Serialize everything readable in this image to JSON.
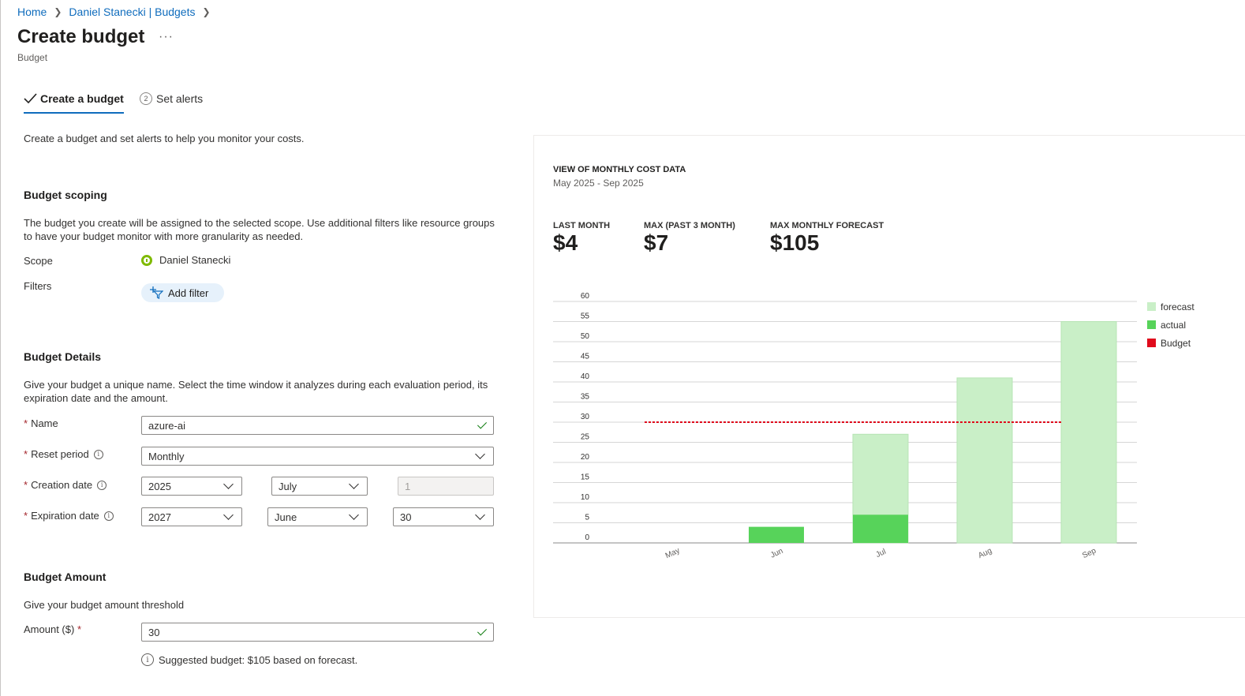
{
  "breadcrumb": {
    "home": "Home",
    "parent": "Daniel Stanecki | Budgets"
  },
  "page": {
    "title": "Create budget",
    "more": "···",
    "subtitle": "Budget"
  },
  "tabs": [
    {
      "label": "Create a budget",
      "state": "complete"
    },
    {
      "label": "Set alerts",
      "step": "2"
    }
  ],
  "intro": "Create a budget and set alerts to help you monitor your costs.",
  "scoping": {
    "title": "Budget scoping",
    "description": "The budget you create will be assigned to the selected scope. Use additional filters like resource groups to have your budget monitor with more granularity as needed.",
    "scope_label": "Scope",
    "scope_value": "Daniel Stanecki",
    "filters_label": "Filters",
    "add_filter": "Add filter"
  },
  "details": {
    "title": "Budget Details",
    "description": "Give your budget a unique name. Select the time window it analyzes during each evaluation period, its expiration date and the amount.",
    "name_label": "Name",
    "name_value": "azure-ai",
    "reset_label": "Reset period",
    "reset_value": "Monthly",
    "creation_label": "Creation date",
    "creation_year": "2025",
    "creation_month": "July",
    "creation_day": "1",
    "expiration_label": "Expiration date",
    "expiration_year": "2027",
    "expiration_month": "June",
    "expiration_day": "30"
  },
  "amount": {
    "title": "Budget Amount",
    "description": "Give your budget amount threshold",
    "label": "Amount ($)",
    "value": "30",
    "suggestion": "Suggested budget: $105 based on forecast."
  },
  "summary": {
    "title": "VIEW OF MONTHLY COST DATA",
    "range": "May 2025 - Sep 2025",
    "kpis": [
      {
        "label": "LAST MONTH",
        "value": "$4"
      },
      {
        "label": "MAX (PAST 3 MONTH)",
        "value": "$7"
      },
      {
        "label": "MAX MONTHLY FORECAST",
        "value": "$105"
      }
    ]
  },
  "colors": {
    "forecast": "#c9efc7",
    "actual": "#57d35a",
    "budget": "#e00b1c",
    "accent": "#0f6cbd"
  },
  "chart_data": {
    "type": "bar",
    "categories": [
      "May",
      "Jun",
      "Jul",
      "Aug",
      "Sep"
    ],
    "series": [
      {
        "name": "forecast",
        "values": [
          0,
          0,
          27,
          41,
          55
        ]
      },
      {
        "name": "actual",
        "values": [
          0,
          4,
          7,
          0,
          0
        ]
      },
      {
        "name": "Budget",
        "values": [
          30,
          30,
          30,
          30,
          30
        ]
      }
    ],
    "yticks": [
      0,
      5,
      10,
      15,
      20,
      25,
      30,
      35,
      40,
      45,
      50,
      55,
      60
    ],
    "ylim": [
      0,
      60
    ],
    "grid": true,
    "legend": "right"
  }
}
